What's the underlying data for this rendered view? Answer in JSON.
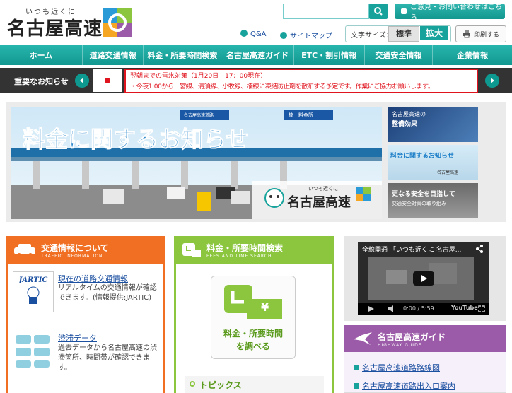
{
  "header": {
    "tagline": "いつも近くに",
    "logo_text": "名古屋高速",
    "search": {
      "placeholder": ""
    },
    "contact_label": "ご意見・お問い合わせはこちら",
    "qa_label": "Q&A",
    "sitemap_label": "サイトマップ",
    "fontsize_label": "文字サイズ：",
    "fontsize_standard": "標準",
    "fontsize_large": "拡大",
    "print_label": "印刷する"
  },
  "nav": {
    "items": [
      "ホーム",
      "道路交通情報",
      "料金・所要時間検索",
      "名古屋高速ガイド",
      "ETC・割引情報",
      "交通安全情報",
      "企業情報"
    ]
  },
  "news": {
    "label": "重要なお知らせ",
    "alert_title": "翌朝までの雪氷対策（1月20日　17：00現在）",
    "alert_body": "・今夜1:00から一宮線、清須線、小牧線、楠線に凍結防止剤を散布する予定です。作業にご協力お願いします。"
  },
  "banner": {
    "main_text": "料金に関するお知らせ",
    "main_logo_tag": "いつも近くに",
    "main_logo": "名古屋高速",
    "booth_sign1": "名古屋高速道路",
    "booth_sign2": "楠　料金所",
    "side": [
      {
        "line1": "名古屋高速の",
        "line2": "整備効果"
      },
      {
        "line1": "料金に関するお知らせ",
        "line2": "名古屋高速"
      },
      {
        "line1": "更なる安全を目指して",
        "line2": "交通安全対策の取り組み"
      }
    ]
  },
  "traffic": {
    "title": "交通情報について",
    "subtitle": "TRAFFIC INFORMATION",
    "jartic_logo": "JARTIC",
    "item1_link": "現在の道路交通情報",
    "item1_desc": "リアルタイムの交通情報が確認できます。(情報提供:JARTIC)",
    "item2_link": "渋滞データ",
    "item2_desc": "過去データから名古屋高速の渋滞箇所、時間帯が確認できます。"
  },
  "fee": {
    "title": "料金・所要時間検索",
    "subtitle": "FEES AND TIME SEARCH",
    "yen": "¥",
    "button_line1": "料金・所要時間",
    "button_line2": "を調べる",
    "topics": "トピックス"
  },
  "video": {
    "title": "全線開通 「いつも近くに 名古屋...",
    "time": "0:00 / 5:59",
    "brand": "YouTube"
  },
  "guide": {
    "title": "名古屋高速ガイド",
    "subtitle": "HIGHWAY GUIDE",
    "links": [
      "名古屋高速道路路線図",
      "名古屋高速道路出入口案内"
    ]
  },
  "colors": {
    "teal": "#17a39b",
    "orange": "#f06f22",
    "green": "#8cc63f",
    "purple": "#9b5ba8",
    "alert_red": "#e0141e"
  }
}
